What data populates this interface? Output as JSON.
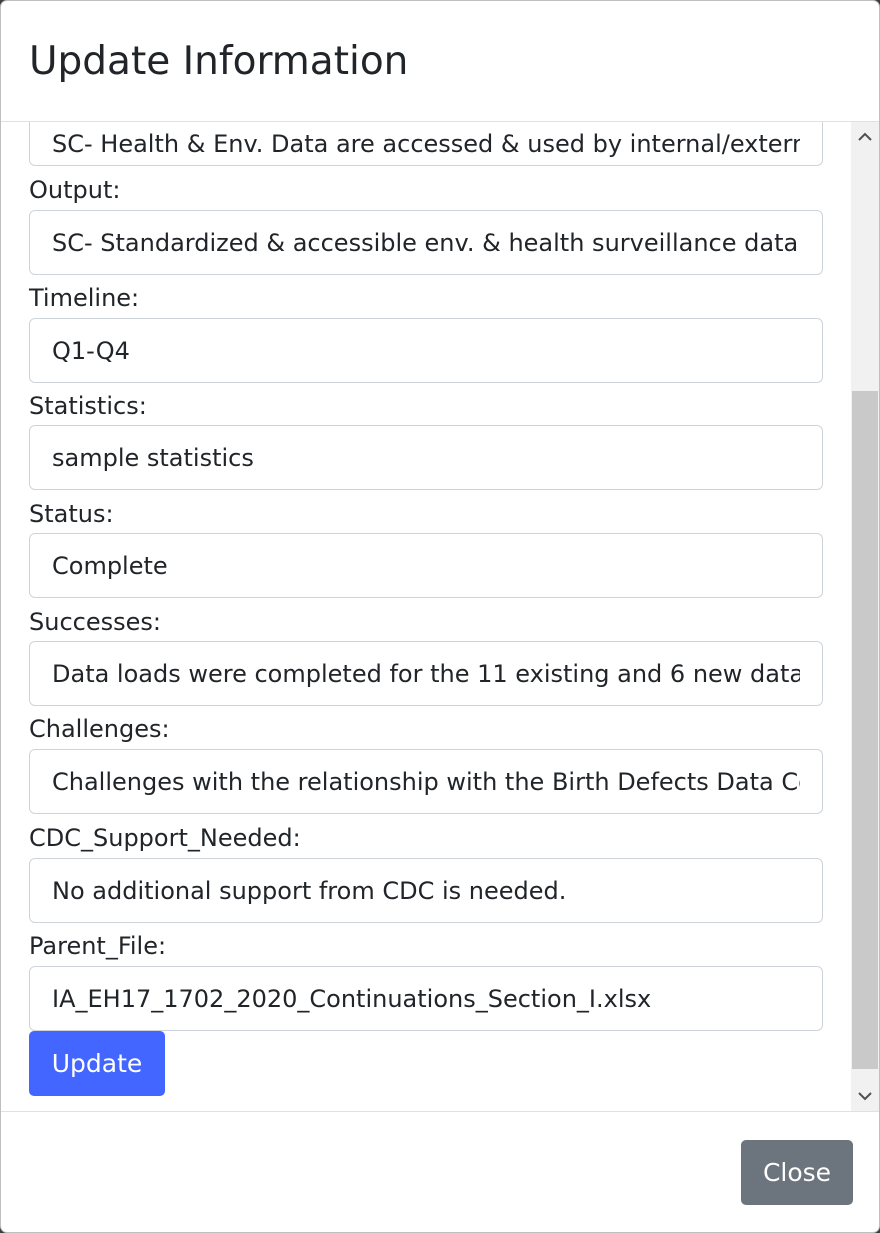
{
  "header": {
    "title": "Update Information"
  },
  "form": {
    "fields": [
      {
        "label": "",
        "value": "SC- Health & Env. Data are accessed & used by internal/external partners"
      },
      {
        "label": "Output:",
        "value": "SC- Standardized & accessible env. & health surveillance data"
      },
      {
        "label": "Timeline:",
        "value": "Q1-Q4"
      },
      {
        "label": "Statistics:",
        "value": "sample statistics"
      },
      {
        "label": "Status:",
        "value": "Complete"
      },
      {
        "label": "Successes:",
        "value": "Data loads were completed for the 11 existing and 6 new data"
      },
      {
        "label": "Challenges:",
        "value": "Challenges with the relationship with the Birth Defects Data Collection"
      },
      {
        "label": "CDC_Support_Needed:",
        "value": "No additional support from CDC is needed."
      },
      {
        "label": "Parent_File:",
        "value": "IA_EH17_1702_2020_Continuations_Section_I.xlsx"
      }
    ],
    "update_label": "Update"
  },
  "footer": {
    "close_label": "Close"
  },
  "scrollbar": {
    "scroll_position_fraction": 0.27,
    "visible_fraction": 0.69
  },
  "colors": {
    "primary": "#4266ff",
    "secondary": "#6c757d"
  }
}
